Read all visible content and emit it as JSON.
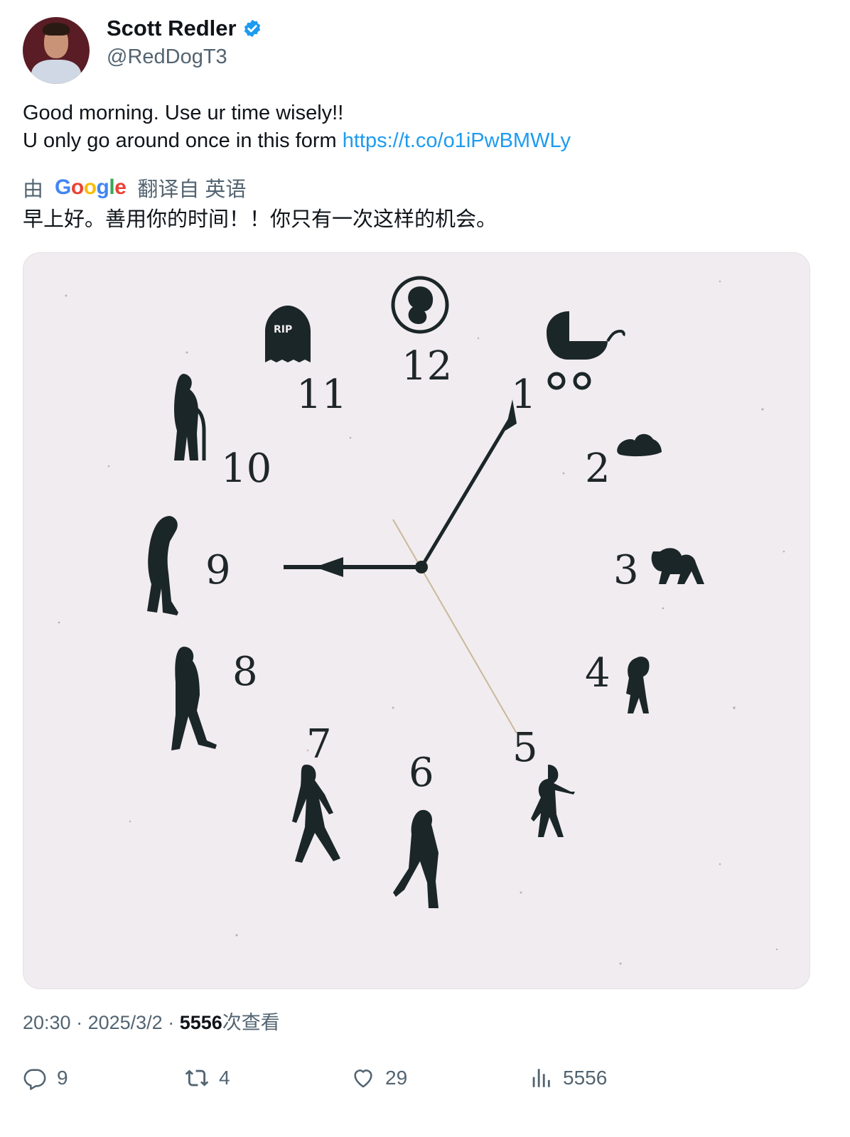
{
  "author": {
    "name": "Scott Redler",
    "handle": "@RedDogT3",
    "verified": true
  },
  "tweet": {
    "line1": "Good morning.  Use ur time wisely!!",
    "line2_prefix": "U only go around once in this form ",
    "link": "https://t.co/o1iPwBMWLy"
  },
  "translation": {
    "by": "由",
    "provider": "Google",
    "from_label": "翻译自 英语",
    "text": "早上好。善用你的时间！！你只有一次这样的机会。"
  },
  "clock_image": {
    "numbers": [
      "12",
      "1",
      "2",
      "3",
      "4",
      "5",
      "6",
      "7",
      "8",
      "9",
      "10",
      "11"
    ],
    "tombstone_text": "RIP"
  },
  "meta": {
    "time": "20:30",
    "sep1": " · ",
    "date": "2025/3/2",
    "sep2": " · ",
    "views_count": "5556",
    "views_label": "次查看"
  },
  "actions": {
    "replies": "9",
    "retweets": "4",
    "likes": "29",
    "views": "5556"
  },
  "colors": {
    "link": "#1d9bf0",
    "verified": "#1d9bf0",
    "secondary_text": "#536471",
    "clock_bg": "#f1ecef"
  }
}
